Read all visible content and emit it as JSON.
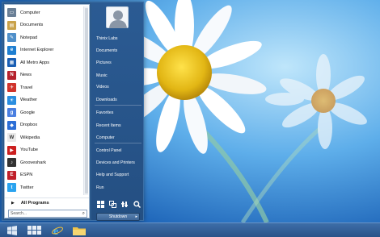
{
  "programs": [
    {
      "label": "Computer",
      "icon": "computer-icon",
      "color": "#6a7f96"
    },
    {
      "label": "Documents",
      "icon": "documents-icon",
      "color": "#c9a24a"
    },
    {
      "label": "Notepad",
      "icon": "notepad-icon",
      "color": "#4f8fc9"
    },
    {
      "label": "Internet Explorer",
      "icon": "internet-explorer-icon",
      "color": "#1f7fd1"
    },
    {
      "label": "All Metro Apps",
      "icon": "metro-apps-icon",
      "color": "#1a5fb4"
    },
    {
      "label": "News",
      "icon": "news-icon",
      "color": "#b5222d"
    },
    {
      "label": "Travel",
      "icon": "travel-icon",
      "color": "#d0342c"
    },
    {
      "label": "Weather",
      "icon": "weather-icon",
      "color": "#2a8ee0"
    },
    {
      "label": "Google",
      "icon": "google-icon",
      "color": "#4a7fe0"
    },
    {
      "label": "Dropbox",
      "icon": "dropbox-icon",
      "color": "#2d6fd6"
    },
    {
      "label": "Wikipedia",
      "icon": "wikipedia-icon",
      "color": "#e9e9e9"
    },
    {
      "label": "YouTube",
      "icon": "youtube-icon",
      "color": "#cc2020"
    },
    {
      "label": "Grooveshark",
      "icon": "grooveshark-icon",
      "color": "#333333"
    },
    {
      "label": "ESPN",
      "icon": "espn-icon",
      "color": "#c0202a"
    },
    {
      "label": "Twitter",
      "icon": "twitter-icon",
      "color": "#2aa3ef"
    }
  ],
  "all_programs_label": "All Programs",
  "search_placeholder": "Search...",
  "right_links": [
    "Thinix Labs",
    "Documents",
    "Pictures",
    "Music",
    "Videos",
    "Downloads",
    "Favorites",
    "Recent Items",
    "Computer",
    "Control Panel",
    "Devices and Printers",
    "Help and Support",
    "Run"
  ],
  "shutdown_label": "Shutdown",
  "taskbar": [
    "start-icon",
    "metro-apps-icon",
    "internet-explorer-icon",
    "file-explorer-icon"
  ]
}
